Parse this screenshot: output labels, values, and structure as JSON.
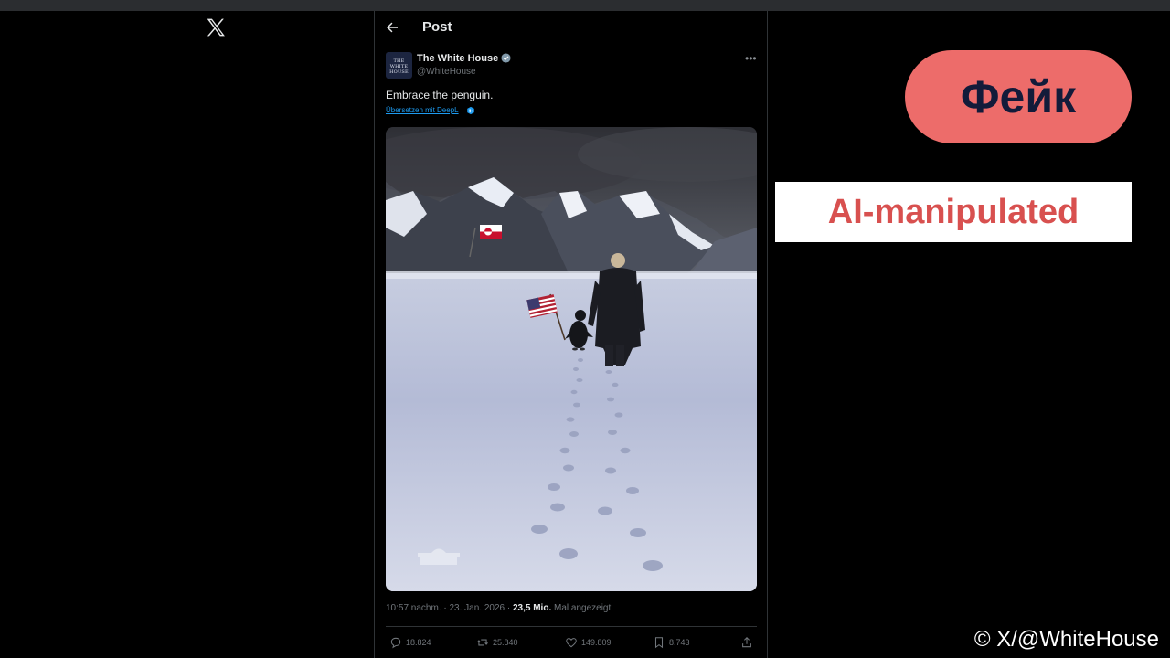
{
  "header": {
    "title": "Post"
  },
  "post": {
    "author_name": "The White House",
    "author_handle": "@WhiteHouse",
    "avatar_text": "THE WHITE HOUSE",
    "text": "Embrace the penguin.",
    "translate_label": "Übersetzen mit DeepL",
    "timestamp": "10:57 nachm. · 23. Jan. 2026 ·",
    "views_count": "23,5 Mio.",
    "views_label": "Mal angezeigt",
    "replies": "18.824",
    "reposts": "25.840",
    "likes": "149.809",
    "bookmarks": "8.743"
  },
  "overlay": {
    "fake_label": "Фейк",
    "ai_label": "AI-manipulated",
    "credit": "© X/@WhiteHouse",
    "fake_bg": "#ed6c6a",
    "fake_text_color": "#131b3a",
    "ai_text_color": "#d8504f"
  },
  "icons": [
    "x-logo-icon",
    "back-arrow-icon",
    "verified-badge-icon",
    "more-icon",
    "deepl-icon",
    "reply-icon",
    "repost-icon",
    "like-icon",
    "bookmark-icon",
    "share-icon"
  ]
}
